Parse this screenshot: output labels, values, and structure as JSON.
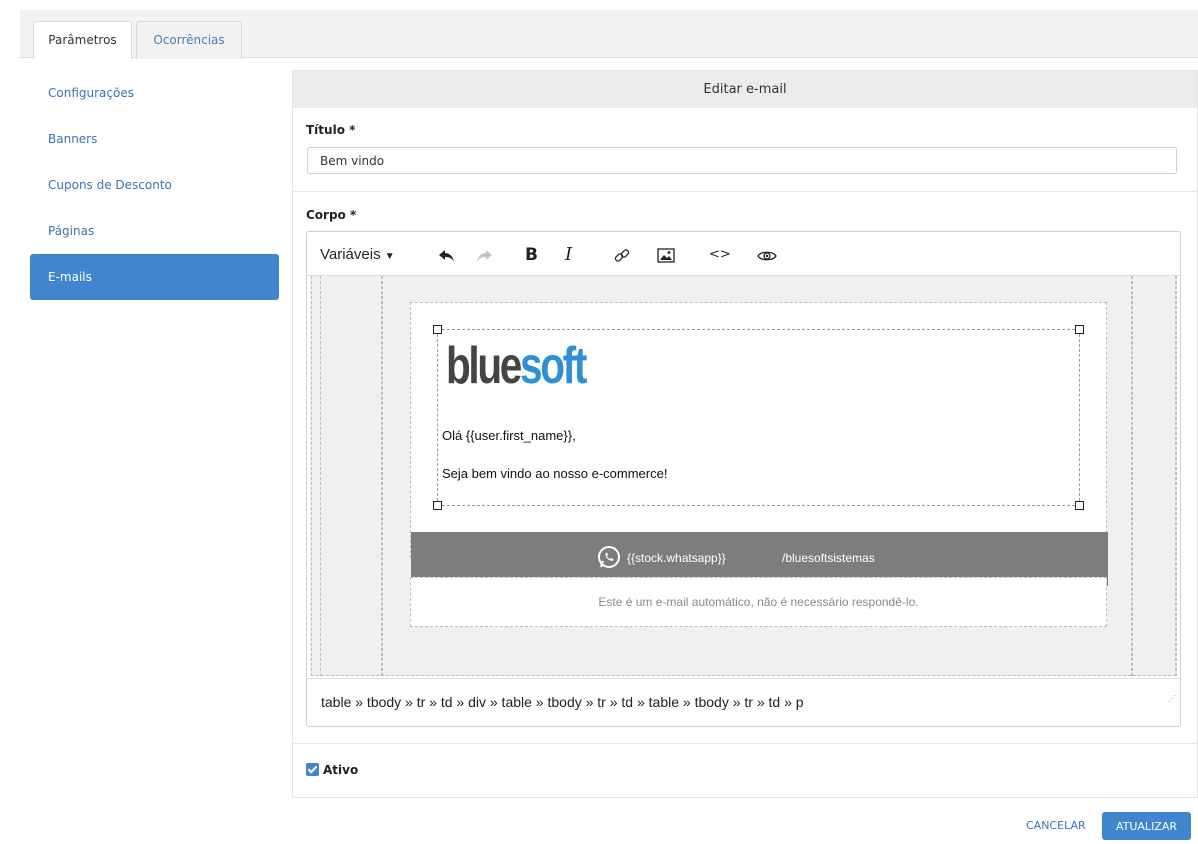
{
  "tabs": [
    {
      "label": "Parâmetros",
      "active": true
    },
    {
      "label": "Ocorrências",
      "active": false
    }
  ],
  "sidebar": {
    "items": [
      {
        "label": "Configurações"
      },
      {
        "label": "Banners"
      },
      {
        "label": "Cupons de Desconto"
      },
      {
        "label": "Páginas"
      },
      {
        "label": "E-mails",
        "active": true
      }
    ]
  },
  "panel": {
    "header": "Editar e-mail",
    "title_label": "Título *",
    "title_value": "Bem vindo",
    "body_label": "Corpo *",
    "active_label": "Ativo",
    "active_checked": true
  },
  "editor": {
    "toolbar": {
      "variables_label": "Variáveis",
      "bold_label": "B",
      "italic_label": "I",
      "code_label": "<>"
    },
    "content": {
      "logo_part1": "blue",
      "logo_part2": "soft",
      "greeting": "Olá {{user.first_name}},",
      "welcome": "Seja bem vindo ao nosso e-commerce!",
      "whatsapp": "{{stock.whatsapp}}",
      "social": "/bluesoftsistemas",
      "footer": "Este é um e-mail automático, não é necessário respondê-lo."
    },
    "path": "table » tbody » tr » td » div » table » tbody » tr » td » table » tbody » tr » td » p"
  },
  "actions": {
    "cancel": "CANCELAR",
    "update": "ATUALIZAR"
  },
  "colors": {
    "accent": "#3f86cf",
    "link": "#3b73b0",
    "logo_blue": "#2f8fd6",
    "footer_bar": "#7d7d7d"
  }
}
